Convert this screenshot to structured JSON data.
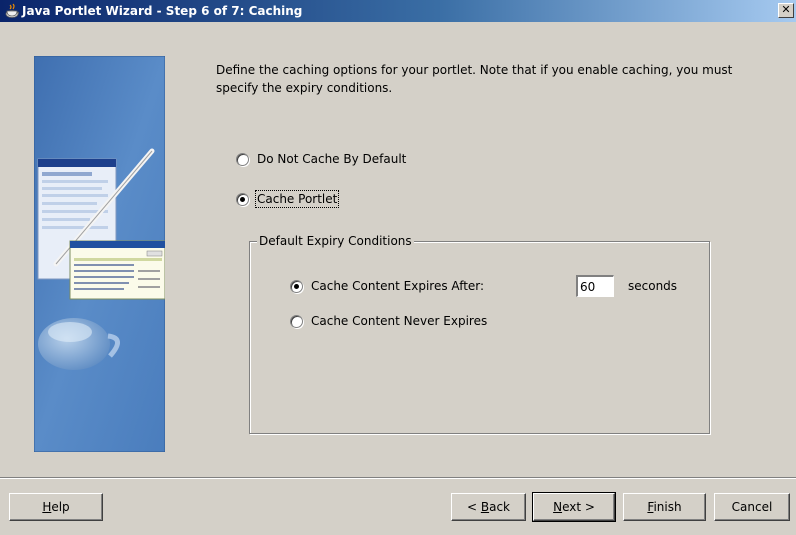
{
  "window": {
    "title": "Java Portlet Wizard - Step 6 of 7: Caching",
    "close_glyph": "✕"
  },
  "intro": {
    "text": "Define the caching options for your portlet. Note that if you enable caching, you must specify the expiry conditions."
  },
  "caching_options": {
    "do_not_cache": {
      "label": "Do Not Cache By Default",
      "selected": false
    },
    "cache_portlet": {
      "label": "Cache Portlet",
      "selected": true
    }
  },
  "expiry": {
    "legend": "Default Expiry Conditions",
    "expires_after": {
      "label": "Cache Content Expires After:",
      "selected": true
    },
    "seconds_value": "60",
    "seconds_unit": "seconds",
    "never_expires": {
      "label": "Cache Content Never Expires",
      "selected": false
    }
  },
  "buttons": {
    "help": {
      "mnemonic": "H",
      "rest": "elp"
    },
    "back": {
      "prefix": "< ",
      "mnemonic": "B",
      "rest": "ack"
    },
    "next": {
      "mnemonic": "N",
      "rest": "ext >"
    },
    "finish": {
      "mnemonic": "F",
      "rest": "inish"
    },
    "cancel": {
      "label": "Cancel"
    }
  },
  "colors": {
    "title_gradient_start": "#0a246a",
    "title_gradient_end": "#a6caf0",
    "dialog_background": "#d4d0c8",
    "side_image_blue": "#4a78b8"
  }
}
